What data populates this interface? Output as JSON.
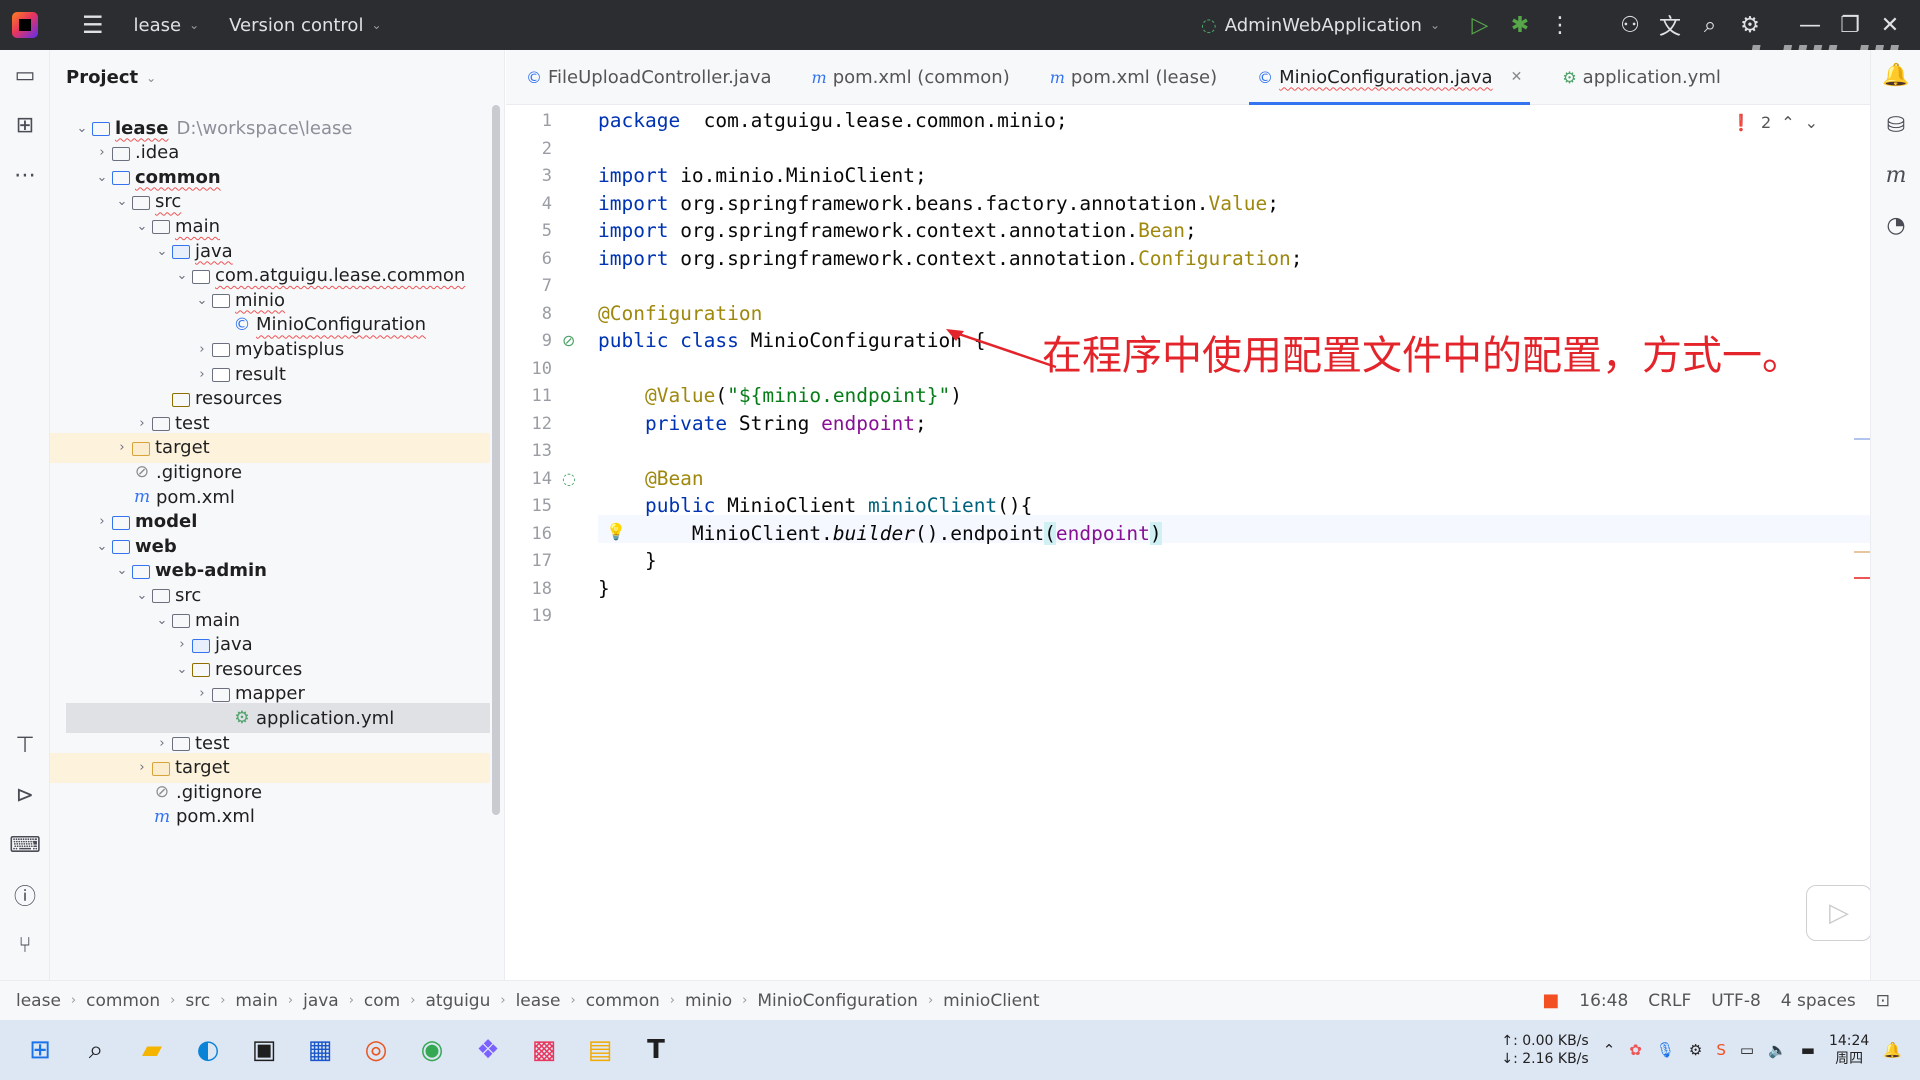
{
  "topbar": {
    "project": "lease",
    "vcs": "Version control",
    "run_config": "AdminWebApplication"
  },
  "project_panel": {
    "title": "Project",
    "rows": [
      {
        "indent": 0,
        "arrow": "⌄",
        "icon": "folder-mod",
        "label": "lease",
        "sub": "D:\\workspace\\lease",
        "bold": true,
        "squig": true
      },
      {
        "indent": 1,
        "arrow": "›",
        "icon": "folder",
        "label": ".idea"
      },
      {
        "indent": 1,
        "arrow": "⌄",
        "icon": "folder-mod",
        "label": "common",
        "bold": true,
        "squig": true
      },
      {
        "indent": 2,
        "arrow": "⌄",
        "icon": "folder",
        "label": "src",
        "squig": true
      },
      {
        "indent": 3,
        "arrow": "⌄",
        "icon": "folder",
        "label": "main",
        "squig": true
      },
      {
        "indent": 4,
        "arrow": "⌄",
        "icon": "folder-src",
        "label": "java",
        "squig": true
      },
      {
        "indent": 5,
        "arrow": "⌄",
        "icon": "folder-pkg",
        "label": "com.atguigu.lease.common",
        "squig": true
      },
      {
        "indent": 6,
        "arrow": "⌄",
        "icon": "folder-pkg",
        "label": "minio",
        "squig": true
      },
      {
        "indent": 7,
        "arrow": "",
        "icon": "class",
        "label": "MinioConfiguration",
        "squig": true
      },
      {
        "indent": 6,
        "arrow": "›",
        "icon": "folder-pkg",
        "label": "mybatisplus"
      },
      {
        "indent": 6,
        "arrow": "›",
        "icon": "folder-pkg",
        "label": "result"
      },
      {
        "indent": 4,
        "arrow": "",
        "icon": "folder-res",
        "label": "resources"
      },
      {
        "indent": 3,
        "arrow": "›",
        "icon": "folder",
        "label": "test"
      },
      {
        "indent": 2,
        "arrow": "›",
        "icon": "folder-tgt",
        "label": "target",
        "hl": true
      },
      {
        "indent": 2,
        "arrow": "",
        "icon": "ignore",
        "label": ".gitignore"
      },
      {
        "indent": 2,
        "arrow": "",
        "icon": "maven",
        "label": "pom.xml"
      },
      {
        "indent": 1,
        "arrow": "›",
        "icon": "folder-mod",
        "label": "model",
        "bold": true
      },
      {
        "indent": 1,
        "arrow": "⌄",
        "icon": "folder-mod",
        "label": "web",
        "bold": true
      },
      {
        "indent": 2,
        "arrow": "⌄",
        "icon": "folder-mod",
        "label": "web-admin",
        "bold": true
      },
      {
        "indent": 3,
        "arrow": "⌄",
        "icon": "folder",
        "label": "src"
      },
      {
        "indent": 4,
        "arrow": "⌄",
        "icon": "folder",
        "label": "main"
      },
      {
        "indent": 5,
        "arrow": "›",
        "icon": "folder-src",
        "label": "java"
      },
      {
        "indent": 5,
        "arrow": "⌄",
        "icon": "folder-res",
        "label": "resources"
      },
      {
        "indent": 6,
        "arrow": "›",
        "icon": "folder",
        "label": "mapper"
      },
      {
        "indent": 7,
        "arrow": "",
        "icon": "yml",
        "label": "application.yml",
        "sel": true
      },
      {
        "indent": 4,
        "arrow": "›",
        "icon": "folder",
        "label": "test"
      },
      {
        "indent": 3,
        "arrow": "›",
        "icon": "folder-tgt",
        "label": "target",
        "hl": true
      },
      {
        "indent": 3,
        "arrow": "",
        "icon": "ignore",
        "label": ".gitignore"
      },
      {
        "indent": 3,
        "arrow": "",
        "icon": "maven",
        "label": "pom.xml"
      }
    ]
  },
  "tabs": [
    {
      "icon": "©",
      "label": "FileUploadController.java"
    },
    {
      "icon": "m",
      "label": "pom.xml (common)"
    },
    {
      "icon": "m",
      "label": "pom.xml (lease)"
    },
    {
      "icon": "©",
      "label": "MinioConfiguration.java",
      "active": true
    },
    {
      "icon": "yml",
      "label": "application.yml"
    }
  ],
  "editor": {
    "error_count": "2",
    "lines": [
      [
        [
          "kw",
          "package"
        ],
        [
          "",
          "  com.atguigu.lease.common.minio;"
        ]
      ],
      [],
      [
        [
          "kw",
          "import"
        ],
        [
          "",
          " io.minio.MinioClient;"
        ]
      ],
      [
        [
          "kw",
          "import"
        ],
        [
          "",
          " org.springframework.beans.factory.annotation."
        ],
        [
          "an",
          "Value"
        ],
        [
          "",
          ";"
        ]
      ],
      [
        [
          "kw",
          "import"
        ],
        [
          "",
          " org.springframework.context.annotation."
        ],
        [
          "an",
          "Bean"
        ],
        [
          "",
          ";"
        ]
      ],
      [
        [
          "kw",
          "import"
        ],
        [
          "",
          " org.springframework.context.annotation."
        ],
        [
          "an",
          "Configuration"
        ],
        [
          "",
          ";"
        ]
      ],
      [],
      [
        [
          "an",
          "@Configuration"
        ]
      ],
      [
        [
          "kw",
          "public class"
        ],
        [
          "",
          " MinioConfiguration {"
        ]
      ],
      [],
      [
        [
          "an",
          "    @Value"
        ],
        [
          "",
          "("
        ],
        [
          "st",
          "\"${minio.endpoint}\""
        ],
        [
          "",
          ")"
        ]
      ],
      [
        [
          "kw",
          "    private"
        ],
        [
          "",
          " String "
        ],
        [
          "fld",
          "endpoint"
        ],
        [
          "",
          ";"
        ]
      ],
      [],
      [
        [
          "an",
          "    @Bean"
        ]
      ],
      [
        [
          "kw",
          "    public"
        ],
        [
          "",
          " MinioClient "
        ],
        [
          "mth",
          "minioClient"
        ],
        [
          "",
          "(){"
        ]
      ],
      [
        [
          "",
          "        MinioClient."
        ],
        [
          "it",
          "builder"
        ],
        [
          "",
          "().endpoint"
        ],
        [
          "cur",
          "("
        ],
        [
          "fld",
          "endpoint"
        ],
        [
          "cur",
          ")"
        ]
      ],
      [
        [
          "",
          "    }"
        ]
      ],
      [
        [
          "",
          "}"
        ]
      ],
      []
    ]
  },
  "annotation": "在程序中使用配置文件中的配置，方式一。",
  "statusbar": {
    "breadcrumb": [
      "lease",
      "common",
      "src",
      "main",
      "java",
      "com",
      "atguigu",
      "lease",
      "common",
      "minio",
      "MinioConfiguration",
      "minioClient"
    ],
    "position": "16:48",
    "line_sep": "CRLF",
    "encoding": "UTF-8",
    "indent": "4 spaces"
  },
  "taskbar": {
    "net_up": "↑: 0.00 KB/s",
    "net_down": "↓: 2.16 KB/s",
    "time": "14:24",
    "day": "周四"
  },
  "watermark": "bilibili"
}
